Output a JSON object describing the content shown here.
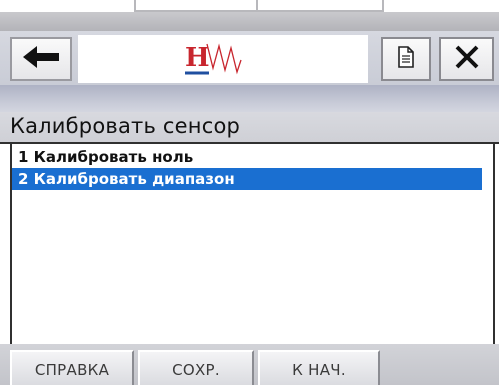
{
  "header": {
    "back_icon": "left-arrow-icon",
    "logo_text": "H",
    "logo_accent_color": "#c8262e",
    "document_icon": "document-icon",
    "close_icon": "close-icon"
  },
  "screen": {
    "title": "Калибровать сенсор"
  },
  "menu": {
    "items": [
      {
        "label": "1 Калибровать ноль",
        "selected": false
      },
      {
        "label": "2 Калибровать диапазон",
        "selected": true
      }
    ],
    "selection_color": "#1a6fd1"
  },
  "softkeys": {
    "help_label": "СПРАВКА",
    "save_label": "СОХР.",
    "home_label": "К НАЧ."
  }
}
